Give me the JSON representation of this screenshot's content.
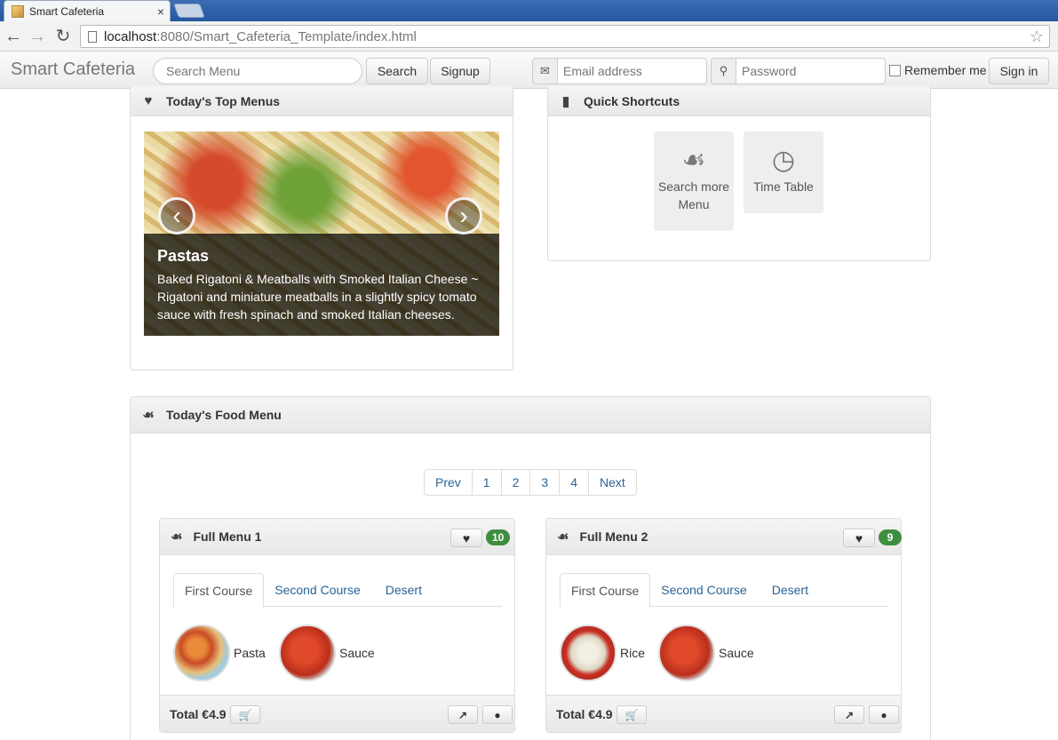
{
  "browser": {
    "tab_title": "Smart Cafeteria",
    "tab_close": "×",
    "url_host": "localhost",
    "url_rest": ":8080/Smart_Cafeteria_Template/index.html"
  },
  "navbar": {
    "brand": "Smart Cafeteria",
    "search_placeholder": "Search Menu",
    "search_label": "Search",
    "signup_label": "Signup",
    "email_placeholder": "Email address",
    "password_placeholder": "Password",
    "remember_label": "Remember me",
    "signin_label": "Sign in"
  },
  "top_menus": {
    "title": "Today's Top Menus",
    "slide": {
      "title": "Pastas",
      "text": "Baked Rigatoni & Meatballs with Smoked Italian Cheese ~ Rigatoni and miniature meatballs in a slightly spicy tomato sauce with fresh spinach and smoked Italian cheeses."
    },
    "prev_glyph": "‹",
    "next_glyph": "›"
  },
  "shortcuts": {
    "title": "Quick Shortcuts",
    "items": [
      {
        "label": "Search more Menu",
        "icon": "cutlery-icon"
      },
      {
        "label": "Time Table",
        "icon": "clock-icon"
      }
    ]
  },
  "food_menu": {
    "title": "Today's Food Menu",
    "pagination": [
      "Prev",
      "1",
      "2",
      "3",
      "4",
      "Next"
    ],
    "cards": [
      {
        "title": "Full Menu 1",
        "likes": "10",
        "tabs": [
          "First Course",
          "Second Course",
          "Desert"
        ],
        "dishes": [
          "Pasta",
          "Sauce"
        ],
        "total": "Total €4.9"
      },
      {
        "title": "Full Menu 2",
        "likes": "9",
        "tabs": [
          "First Course",
          "Second Course",
          "Desert"
        ],
        "dishes": [
          "Rice",
          "Sauce"
        ],
        "total": "Total €4.9"
      }
    ]
  },
  "colors": {
    "badge": "#3e8e41",
    "link": "#2a6496"
  }
}
